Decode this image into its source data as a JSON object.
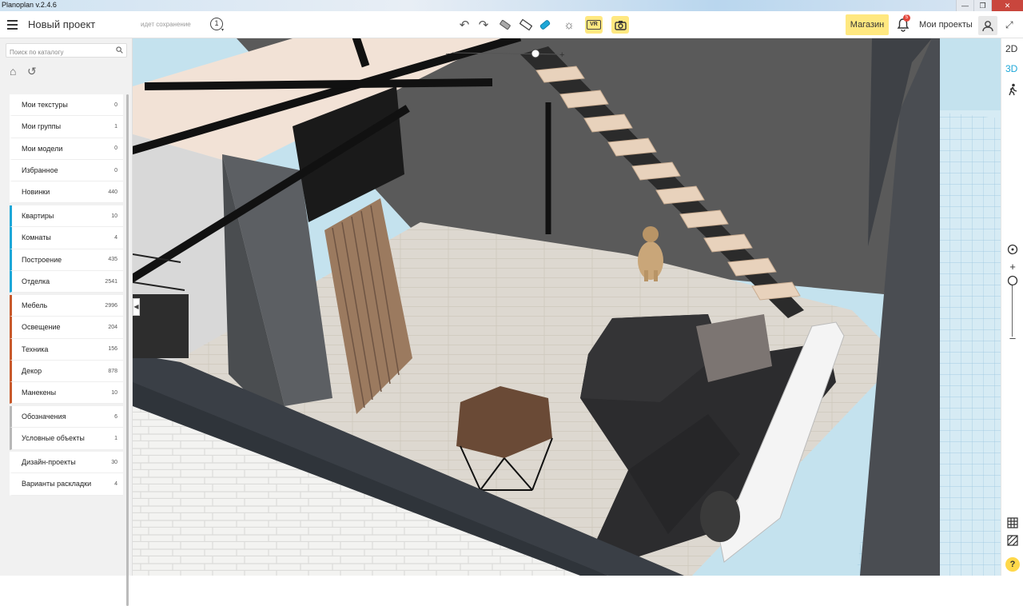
{
  "window": {
    "title": "Planoplan v.2.4.6",
    "controls": [
      "—",
      "❐",
      "✕"
    ]
  },
  "toolbar": {
    "project_name": "Новый проект",
    "save_status": "идет сохранение",
    "level_number": "1",
    "vr_label": "VR",
    "shop_label": "Магазин",
    "notifications_count": "5",
    "my_projects_label": "Мои проекты"
  },
  "sidebar": {
    "search_placeholder": "Поиск по каталогу",
    "groups": [
      {
        "items": [
          {
            "label": "Мои текстуры",
            "count": "0"
          },
          {
            "label": "Мои группы",
            "count": "1"
          },
          {
            "label": "Мои модели",
            "count": "0"
          },
          {
            "label": "Избранное",
            "count": "0"
          },
          {
            "label": "Новинки",
            "count": "440"
          }
        ]
      },
      {
        "color": "blue",
        "items": [
          {
            "label": "Квартиры",
            "count": "10"
          },
          {
            "label": "Комнаты",
            "count": "4"
          },
          {
            "label": "Построение",
            "count": "435"
          },
          {
            "label": "Отделка",
            "count": "2541"
          }
        ]
      },
      {
        "color": "orange",
        "items": [
          {
            "label": "Мебель",
            "count": "2996"
          },
          {
            "label": "Освещение",
            "count": "204"
          },
          {
            "label": "Техника",
            "count": "156"
          },
          {
            "label": "Декор",
            "count": "878"
          },
          {
            "label": "Манекены",
            "count": "10"
          }
        ]
      },
      {
        "color": "gray",
        "items": [
          {
            "label": "Обозначения",
            "count": "6"
          },
          {
            "label": "Условные объекты",
            "count": "1"
          }
        ]
      },
      {
        "items": [
          {
            "label": "Дизайн-проекты",
            "count": "30"
          },
          {
            "label": "Варианты раскладки",
            "count": "4"
          }
        ]
      }
    ]
  },
  "view_modes": {
    "mode_2d": "2D",
    "mode_3d": "3D",
    "active": "3D"
  },
  "right_panel": {
    "zoom_in": "+",
    "zoom_out": "–",
    "help": "?"
  },
  "colors": {
    "accent_yellow": "#ffe880",
    "accent_blue": "#1da7d8",
    "accent_orange": "#c8592b",
    "notification_red": "#e3473c"
  },
  "scene": {
    "content": "3D view of a loft room",
    "slider_min": "–",
    "slider_max": "+"
  }
}
